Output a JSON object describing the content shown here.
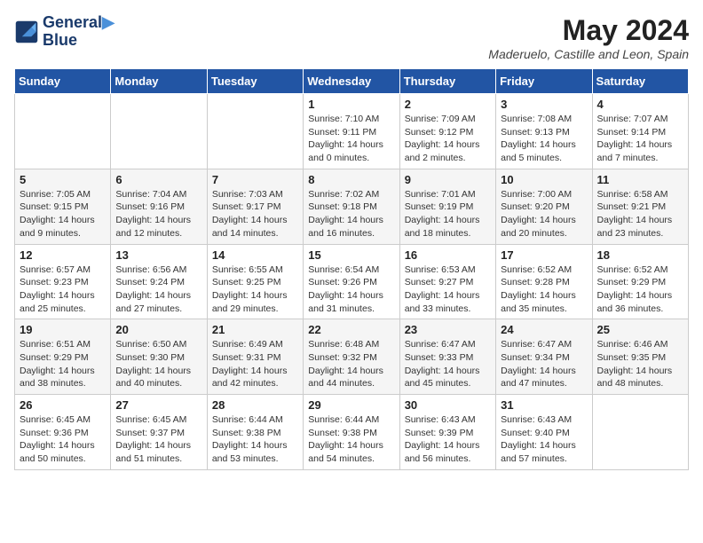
{
  "header": {
    "logo_line1": "General",
    "logo_line2": "Blue",
    "month_year": "May 2024",
    "location": "Maderuelo, Castille and Leon, Spain"
  },
  "weekdays": [
    "Sunday",
    "Monday",
    "Tuesday",
    "Wednesday",
    "Thursday",
    "Friday",
    "Saturday"
  ],
  "weeks": [
    [
      {
        "day": "",
        "info": ""
      },
      {
        "day": "",
        "info": ""
      },
      {
        "day": "",
        "info": ""
      },
      {
        "day": "1",
        "info": "Sunrise: 7:10 AM\nSunset: 9:11 PM\nDaylight: 14 hours\nand 0 minutes."
      },
      {
        "day": "2",
        "info": "Sunrise: 7:09 AM\nSunset: 9:12 PM\nDaylight: 14 hours\nand 2 minutes."
      },
      {
        "day": "3",
        "info": "Sunrise: 7:08 AM\nSunset: 9:13 PM\nDaylight: 14 hours\nand 5 minutes."
      },
      {
        "day": "4",
        "info": "Sunrise: 7:07 AM\nSunset: 9:14 PM\nDaylight: 14 hours\nand 7 minutes."
      }
    ],
    [
      {
        "day": "5",
        "info": "Sunrise: 7:05 AM\nSunset: 9:15 PM\nDaylight: 14 hours\nand 9 minutes."
      },
      {
        "day": "6",
        "info": "Sunrise: 7:04 AM\nSunset: 9:16 PM\nDaylight: 14 hours\nand 12 minutes."
      },
      {
        "day": "7",
        "info": "Sunrise: 7:03 AM\nSunset: 9:17 PM\nDaylight: 14 hours\nand 14 minutes."
      },
      {
        "day": "8",
        "info": "Sunrise: 7:02 AM\nSunset: 9:18 PM\nDaylight: 14 hours\nand 16 minutes."
      },
      {
        "day": "9",
        "info": "Sunrise: 7:01 AM\nSunset: 9:19 PM\nDaylight: 14 hours\nand 18 minutes."
      },
      {
        "day": "10",
        "info": "Sunrise: 7:00 AM\nSunset: 9:20 PM\nDaylight: 14 hours\nand 20 minutes."
      },
      {
        "day": "11",
        "info": "Sunrise: 6:58 AM\nSunset: 9:21 PM\nDaylight: 14 hours\nand 23 minutes."
      }
    ],
    [
      {
        "day": "12",
        "info": "Sunrise: 6:57 AM\nSunset: 9:23 PM\nDaylight: 14 hours\nand 25 minutes."
      },
      {
        "day": "13",
        "info": "Sunrise: 6:56 AM\nSunset: 9:24 PM\nDaylight: 14 hours\nand 27 minutes."
      },
      {
        "day": "14",
        "info": "Sunrise: 6:55 AM\nSunset: 9:25 PM\nDaylight: 14 hours\nand 29 minutes."
      },
      {
        "day": "15",
        "info": "Sunrise: 6:54 AM\nSunset: 9:26 PM\nDaylight: 14 hours\nand 31 minutes."
      },
      {
        "day": "16",
        "info": "Sunrise: 6:53 AM\nSunset: 9:27 PM\nDaylight: 14 hours\nand 33 minutes."
      },
      {
        "day": "17",
        "info": "Sunrise: 6:52 AM\nSunset: 9:28 PM\nDaylight: 14 hours\nand 35 minutes."
      },
      {
        "day": "18",
        "info": "Sunrise: 6:52 AM\nSunset: 9:29 PM\nDaylight: 14 hours\nand 36 minutes."
      }
    ],
    [
      {
        "day": "19",
        "info": "Sunrise: 6:51 AM\nSunset: 9:29 PM\nDaylight: 14 hours\nand 38 minutes."
      },
      {
        "day": "20",
        "info": "Sunrise: 6:50 AM\nSunset: 9:30 PM\nDaylight: 14 hours\nand 40 minutes."
      },
      {
        "day": "21",
        "info": "Sunrise: 6:49 AM\nSunset: 9:31 PM\nDaylight: 14 hours\nand 42 minutes."
      },
      {
        "day": "22",
        "info": "Sunrise: 6:48 AM\nSunset: 9:32 PM\nDaylight: 14 hours\nand 44 minutes."
      },
      {
        "day": "23",
        "info": "Sunrise: 6:47 AM\nSunset: 9:33 PM\nDaylight: 14 hours\nand 45 minutes."
      },
      {
        "day": "24",
        "info": "Sunrise: 6:47 AM\nSunset: 9:34 PM\nDaylight: 14 hours\nand 47 minutes."
      },
      {
        "day": "25",
        "info": "Sunrise: 6:46 AM\nSunset: 9:35 PM\nDaylight: 14 hours\nand 48 minutes."
      }
    ],
    [
      {
        "day": "26",
        "info": "Sunrise: 6:45 AM\nSunset: 9:36 PM\nDaylight: 14 hours\nand 50 minutes."
      },
      {
        "day": "27",
        "info": "Sunrise: 6:45 AM\nSunset: 9:37 PM\nDaylight: 14 hours\nand 51 minutes."
      },
      {
        "day": "28",
        "info": "Sunrise: 6:44 AM\nSunset: 9:38 PM\nDaylight: 14 hours\nand 53 minutes."
      },
      {
        "day": "29",
        "info": "Sunrise: 6:44 AM\nSunset: 9:38 PM\nDaylight: 14 hours\nand 54 minutes."
      },
      {
        "day": "30",
        "info": "Sunrise: 6:43 AM\nSunset: 9:39 PM\nDaylight: 14 hours\nand 56 minutes."
      },
      {
        "day": "31",
        "info": "Sunrise: 6:43 AM\nSunset: 9:40 PM\nDaylight: 14 hours\nand 57 minutes."
      },
      {
        "day": "",
        "info": ""
      }
    ]
  ]
}
